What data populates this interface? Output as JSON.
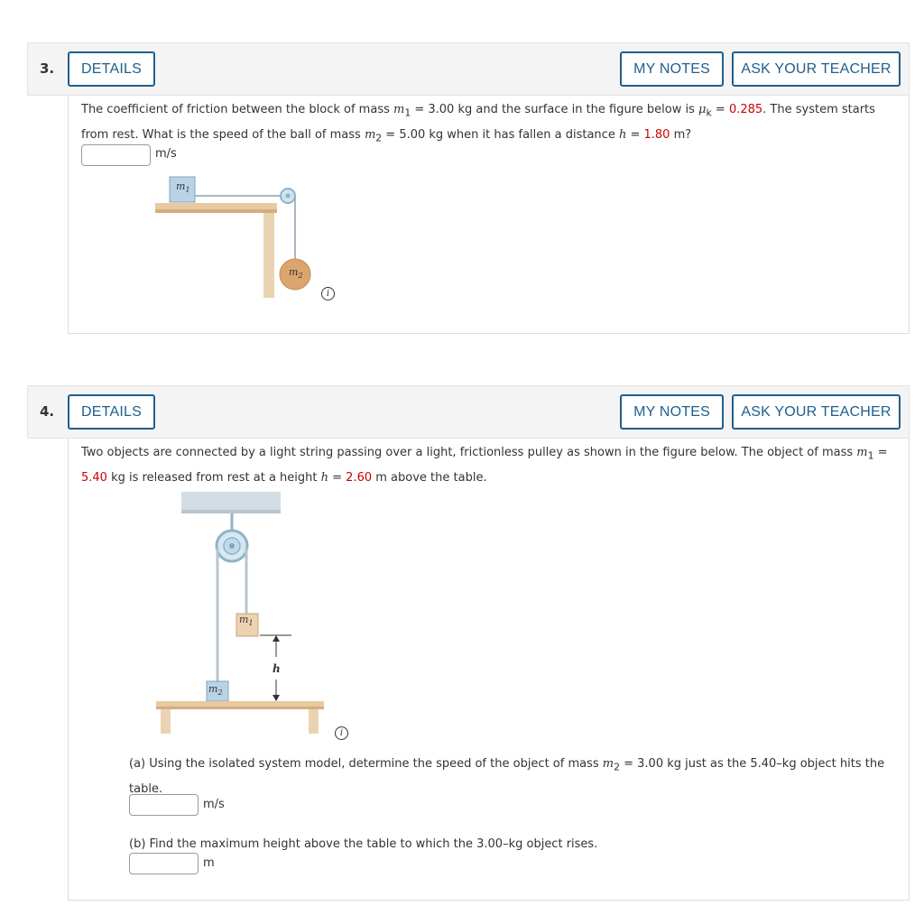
{
  "questions": [
    {
      "number": "3.",
      "details_label": "DETAILS",
      "my_notes_label": "MY NOTES",
      "ask_teacher_label": "ASK YOUR TEACHER",
      "text": {
        "l1_a": "The coefficient of friction between the block of mass ",
        "m": "m",
        "sub1": "1",
        "l1_b": " = 3.00 kg and the surface in the figure below is ",
        "mu": "μ",
        "subk": "k",
        "l1_c": " = ",
        "mu_value": "0.285",
        "l1_d": ". The system starts",
        "l2_a": "from rest. What is the speed of the ball of mass ",
        "sub2": "2",
        "l2_b": " = 5.00 kg when it has fallen a distance ",
        "h": "h",
        "l2_c": " = ",
        "h_value": "1.80",
        "l2_d": " m?"
      },
      "unit": "m/s",
      "figure": {
        "m1_label": "m",
        "m1_sub": "1",
        "m2_label": "m",
        "m2_sub": "2",
        "info_glyph": "i"
      }
    },
    {
      "number": "4.",
      "details_label": "DETAILS",
      "my_notes_label": "MY NOTES",
      "ask_teacher_label": "ASK YOUR TEACHER",
      "text": {
        "l1_a": "Two objects are connected by a light string passing over a light, frictionless pulley as shown in the figure below. The object of mass ",
        "m": "m",
        "sub1": "1",
        "l1_b": " =",
        "m1_value": "5.40",
        "l2_a": " kg is released from rest at a height ",
        "h": "h",
        "l2_b": " = ",
        "h_value": "2.60",
        "l2_c": " m above the table."
      },
      "figure": {
        "m1_label": "m",
        "m1_sub": "1",
        "m2_label": "m",
        "m2_sub": "2",
        "h_label": "h",
        "info_glyph": "i"
      },
      "part_a": {
        "l1_a": "(a) Using the isolated system model, determine the speed of the object of mass ",
        "m": "m",
        "sub2": "2",
        "l1_b": " = 3.00 kg just as the 5.40–kg object hits the",
        "l2": "table.",
        "unit": "m/s"
      },
      "part_b": {
        "text": "(b) Find the maximum height above the table to which the 3.00–kg object rises.",
        "unit": "m"
      }
    }
  ],
  "colors": {
    "accent": "#1f5f8b",
    "highlight": "#cc0000",
    "header_bg": "#f4f4f4"
  }
}
